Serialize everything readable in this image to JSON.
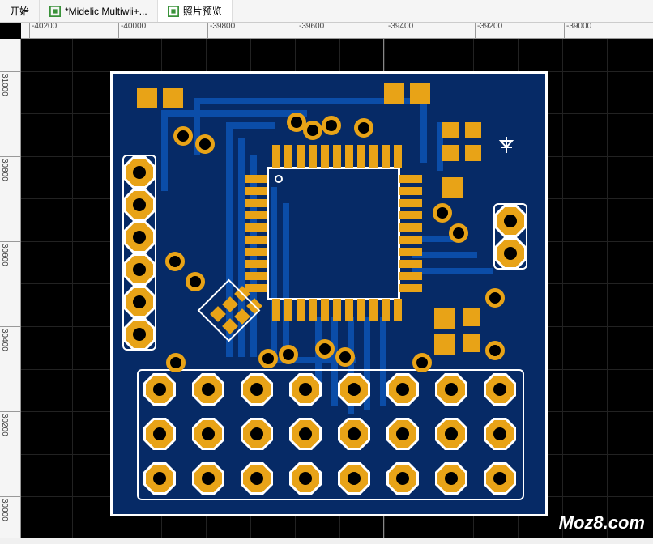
{
  "tabs": [
    {
      "label": "开始",
      "active": false,
      "icon": null
    },
    {
      "label": "*Midelic Multiwii+...",
      "active": false,
      "icon": "pcb"
    },
    {
      "label": "照片预览",
      "active": true,
      "icon": "pcb"
    }
  ],
  "ruler_h": [
    "-40200",
    "-40000",
    "-39800",
    "-39600",
    "-39400",
    "-39200",
    "-39000"
  ],
  "ruler_v": [
    "31000",
    "30800",
    "30600",
    "30400",
    "30200",
    "30000"
  ],
  "watermark": "Moz8.com",
  "colors": {
    "pcb_base": "#062a66",
    "copper": "#e8a317",
    "trace": "#0b4da8",
    "silk": "#ffffff"
  }
}
